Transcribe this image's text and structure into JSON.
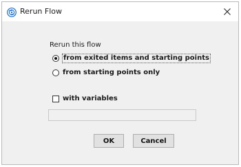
{
  "window": {
    "title": "Rerun Flow",
    "icon": "rerun-flow-app-icon",
    "close_icon": "close-icon"
  },
  "form": {
    "group_label": "Rerun this flow",
    "options": [
      {
        "label": "from exited items and starting points",
        "selected": true
      },
      {
        "label": "from starting points only",
        "selected": false
      }
    ],
    "variables": {
      "label": "with variables",
      "checked": false,
      "value": ""
    }
  },
  "buttons": {
    "ok_label": "OK",
    "cancel_label": "Cancel"
  },
  "colors": {
    "dialog_bg": "#f0f0f0",
    "titlebar_bg": "#ffffff",
    "icon_blue": "#1f6fd1"
  }
}
